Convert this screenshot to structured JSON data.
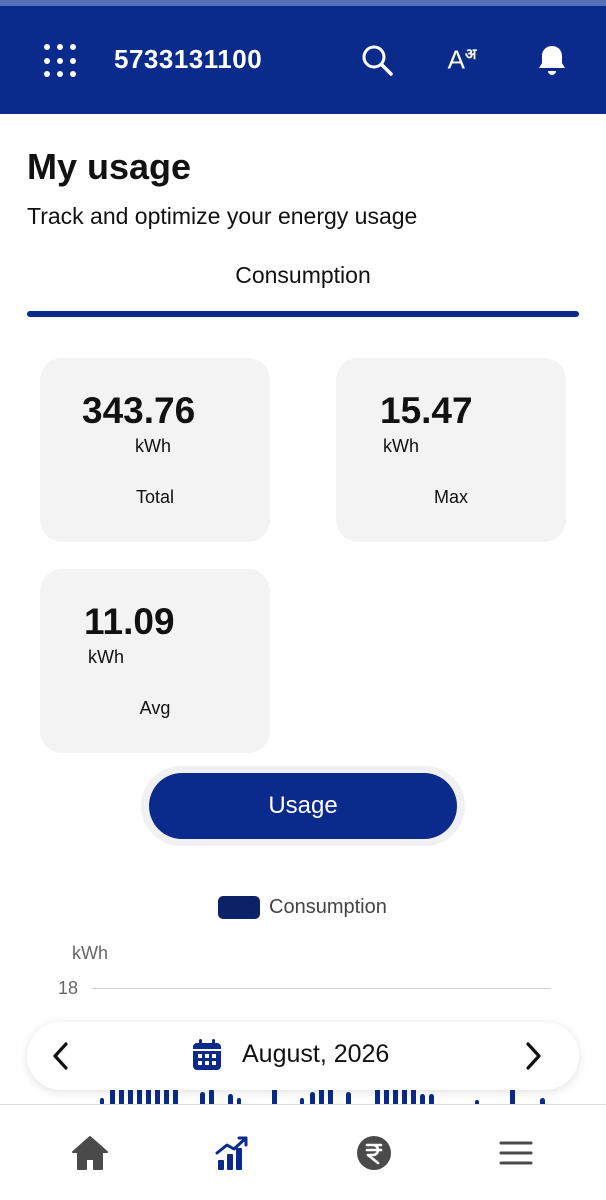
{
  "header": {
    "account_number": "5733131100",
    "icons": [
      "apps-grid-icon",
      "search-icon",
      "language-icon",
      "notification-bell-icon"
    ],
    "language_label": "A",
    "language_sup": "अ",
    "bg_color": "#0a2a8c"
  },
  "page": {
    "title": "My usage",
    "subtitle": "Track and optimize your energy usage",
    "tab": "Consumption"
  },
  "stats": {
    "total": {
      "value": "343.76",
      "unit": "kWh",
      "label": "Total"
    },
    "max": {
      "value": "15.47",
      "unit": "kWh",
      "label": "Max"
    },
    "avg": {
      "value": "11.09",
      "unit": "kWh",
      "label": "Avg"
    }
  },
  "usage_button": "Usage",
  "chart": {
    "legend": "Consumption",
    "y_unit": "kWh",
    "y_tick": "18",
    "bar_color": "#0a2a8c"
  },
  "month_selector": {
    "label": "August, 2026"
  },
  "bottom_nav": {
    "items": [
      "home-icon",
      "usage-chart-icon",
      "rupee-payment-icon",
      "menu-icon"
    ],
    "active_color": "#0a2a8c"
  }
}
